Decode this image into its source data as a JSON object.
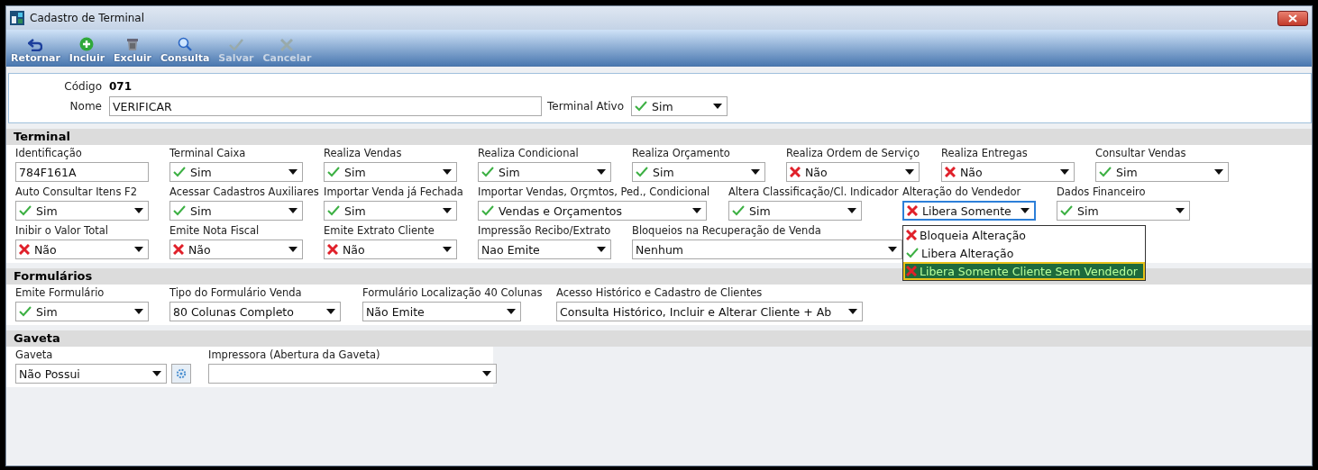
{
  "window": {
    "title": "Cadastro de Terminal"
  },
  "toolbar": [
    {
      "label": "Retornar",
      "disabled": false
    },
    {
      "label": "Incluir",
      "disabled": false
    },
    {
      "label": "Excluir",
      "disabled": false
    },
    {
      "label": "Consulta",
      "disabled": false
    },
    {
      "label": "Salvar",
      "disabled": true
    },
    {
      "label": "Cancelar",
      "disabled": true
    }
  ],
  "header": {
    "codigo_label": "Código",
    "codigo": "071",
    "nome_label": "Nome",
    "nome": "VERIFICAR",
    "ativo_label": "Terminal Ativo",
    "ativo": {
      "value": "Sim",
      "positive": true
    }
  },
  "sections": [
    {
      "title": "Terminal",
      "lines": [
        {
          "fields": [
            {
              "kind": "text",
              "label": "Identificação",
              "value": "784F161A"
            },
            {
              "kind": "combo",
              "label": "Terminal Caixa",
              "value": "Sim",
              "positive": true
            },
            {
              "kind": "combo",
              "label": "Realiza Vendas",
              "value": "Sim",
              "positive": true
            },
            {
              "kind": "combo",
              "label": "Realiza Condicional",
              "value": "Sim",
              "positive": true
            },
            {
              "kind": "combo",
              "label": "Realiza Orçamento",
              "value": "Sim",
              "positive": true
            },
            {
              "kind": "combo",
              "label": "Realiza Ordem de Serviço",
              "value": "Não",
              "positive": false
            },
            {
              "kind": "combo",
              "label": "Realiza Entregas",
              "value": "Não",
              "positive": false
            },
            {
              "kind": "combo",
              "label": "Consultar Vendas",
              "value": "Sim",
              "positive": true
            }
          ]
        },
        {
          "fields": [
            {
              "kind": "combo",
              "label": "Auto Consultar Itens F2",
              "value": "Sim",
              "positive": true
            },
            {
              "kind": "combo",
              "label": "Acessar Cadastros Auxiliares",
              "value": "Sim",
              "positive": true
            },
            {
              "kind": "combo",
              "label": "Importar Venda já Fechada",
              "value": "Sim",
              "positive": true
            },
            {
              "kind": "combo",
              "label": "Importar Vendas, Orçmtos, Ped., Condicional",
              "value": "Vendas e Orçamentos",
              "positive": true
            },
            {
              "kind": "combo",
              "label": "Altera Classificação/Cl. Indicador",
              "value": "Sim",
              "positive": true
            },
            {
              "kind": "combo",
              "label": "Alteração do Vendedor",
              "value": "Libera Somente",
              "positive": false,
              "open": true,
              "options": [
                {
                  "label": "Bloqueia Alteração",
                  "positive": false,
                  "selected": false
                },
                {
                  "label": "Libera Alteração",
                  "positive": true,
                  "selected": false
                },
                {
                  "label": "Libera Somente Cliente Sem Vendedor",
                  "positive": false,
                  "selected": true
                }
              ]
            },
            {
              "kind": "combo",
              "label": "Dados Financeiro",
              "value": "Sim",
              "positive": true
            }
          ]
        },
        {
          "fields": [
            {
              "kind": "combo",
              "label": "Inibir o Valor Total",
              "value": "Não",
              "positive": false
            },
            {
              "kind": "combo",
              "label": "Emite Nota Fiscal",
              "value": "Não",
              "positive": false
            },
            {
              "kind": "combo",
              "label": "Emite Extrato Cliente",
              "value": "Não",
              "positive": false
            },
            {
              "kind": "combo",
              "label": "Impressão Recibo/Extrato",
              "value": "Nao Emite"
            },
            {
              "kind": "combo",
              "label": "Bloqueios na Recuperação de Venda",
              "value": "Nenhum"
            }
          ]
        }
      ]
    },
    {
      "title": "Formulários",
      "lines": [
        {
          "fields": [
            {
              "kind": "combo",
              "label": "Emite Formulário",
              "value": "Sim",
              "positive": true
            },
            {
              "kind": "combo",
              "label": "Tipo do Formulário Venda",
              "value": "80 Colunas Completo"
            },
            {
              "kind": "combo",
              "label": "Formulário Localização 40 Colunas",
              "value": "Não Emite"
            },
            {
              "kind": "combo",
              "label": "Acesso Histórico e Cadastro de Clientes",
              "value": "Consulta Histórico, Incluir e Alterar Cliente + Ab"
            }
          ]
        }
      ]
    },
    {
      "title": "Gaveta",
      "lines": [
        {
          "fields": [
            {
              "kind": "combo",
              "label": "Gaveta",
              "value": "Não Possui",
              "button": true
            },
            {
              "kind": "combo",
              "label": "Impressora (Abertura da Gaveta)"
            }
          ]
        }
      ]
    }
  ]
}
